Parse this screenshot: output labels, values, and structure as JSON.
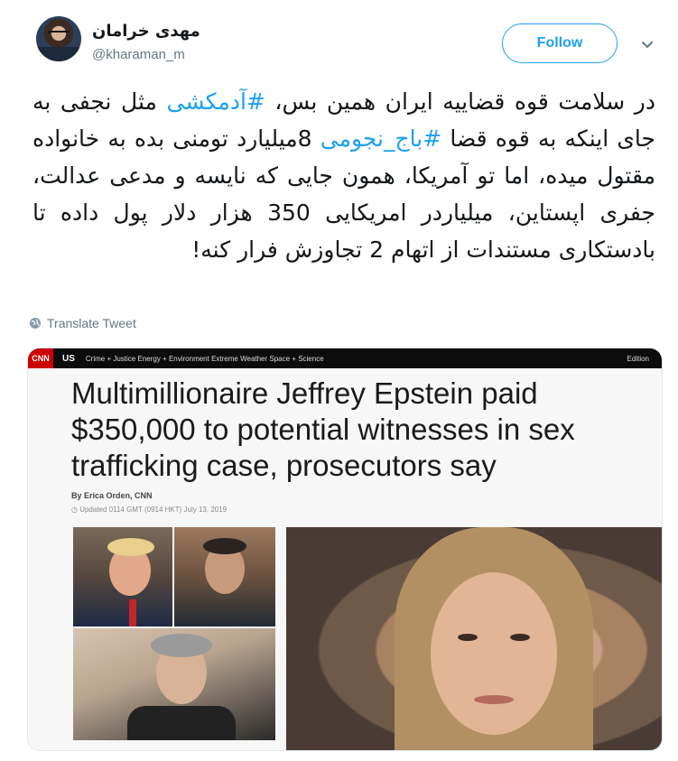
{
  "tweet": {
    "author_name": "مهدی خرامان",
    "author_handle": "@kharaman_m",
    "follow_label": "Follow",
    "text_parts": {
      "p1": "در سلامت قوه قضاییه ایران همین بس، ",
      "hashtag1": "#آدمکشی",
      "p2": " مثل نجفی به جای اینکه به قوه قضا ",
      "hashtag2": "#باج_نجومی",
      "p3": " 8میلیارد تومنی بده به خانواده مقتول میده، اما تو آمریکا، همون جایی که نایسه و مدعی عدالت، جفری اپستاین، میلیاردر امریکایی 350 هزار دلار پول داده تا بادستکاری مستندات از اتهام 2 تجاوزش فرار کنه!"
    },
    "translate_label": "Translate Tweet"
  },
  "media": {
    "cnn_logo": "CNN",
    "edition": "US",
    "nav": "Crime + Justice   Energy + Environment   Extreme Weather   Space + Science",
    "edition_right": "Edition",
    "headline": "Multimillionaire Jeffrey Epstein paid $350,000 to potential witnesses in sex trafficking case, prosecutors say",
    "byline": "By Erica Orden, CNN",
    "updated": "Updated 0114 GMT (0914 HKT) July 13, 2019"
  },
  "colors": {
    "accent": "#1da1f2",
    "secondary_text": "#657786",
    "cnn_red": "#cc0000"
  },
  "icons": {
    "translate": "globe-icon",
    "menu": "chevron-down-icon"
  }
}
